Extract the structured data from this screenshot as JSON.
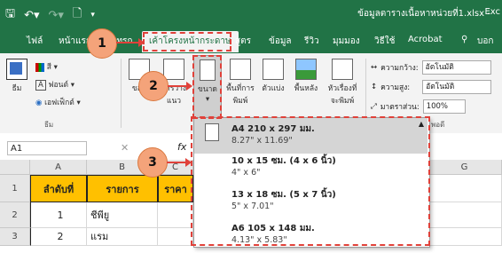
{
  "title_bar": {
    "document_title": "ข้อมูลตารางเนื้อหาหน่วยที่1.xlsx -",
    "app_name": "Exc",
    "save_icon": "save-icon",
    "undo_icon": "undo-icon",
    "redo_icon": "redo-icon",
    "print_preview_icon": "print-preview-icon"
  },
  "tabs": [
    {
      "label": "ไฟล์"
    },
    {
      "label": "หน้าแรก"
    },
    {
      "label": "แทรก"
    },
    {
      "label": "เค้าโครงหน้ากระดาษ",
      "active": true
    },
    {
      "label": "สูตร"
    },
    {
      "label": "ข้อมูล"
    },
    {
      "label": "รีวิว"
    },
    {
      "label": "มุมมอง"
    },
    {
      "label": "วิธีใช้"
    },
    {
      "label": "Acrobat"
    },
    {
      "label": "บอก"
    }
  ],
  "ribbon": {
    "theme": {
      "label": "ธีม",
      "colors": "สี",
      "fonts": "ฟอนต์",
      "effects": "เอฟเฟ็กต์",
      "group": "ธีม"
    },
    "margins": {
      "label": "ขอบ"
    },
    "orientation": {
      "label": "การวาง",
      "sub": "แนว"
    },
    "size": {
      "label": "ขนาด"
    },
    "print_area": {
      "label": "พื้นที่การ",
      "sub": "พิมพ์"
    },
    "breaks": {
      "label": "ตัวแบ่ง"
    },
    "background": {
      "label": "พื้นหลัง"
    },
    "print_titles": {
      "label": "หัวเรื่องที่",
      "sub": "จะพิมพ์"
    },
    "scale_to_fit": {
      "width_label": "ความกว้าง:",
      "width_value": "อัตโนมัติ",
      "height_label": "ความสูง:",
      "height_value": "อัตโนมัติ",
      "scale_label": "มาตราส่วน:",
      "scale_value": "100%",
      "group": "พอดี"
    }
  },
  "formula_bar": {
    "name_box": "A1",
    "fx": "fx"
  },
  "sheet": {
    "columns": [
      "A",
      "B",
      "C",
      "G"
    ],
    "rows": [
      {
        "num": "1",
        "cells": [
          "ลำดับที่",
          "รายการ",
          "ราคา"
        ]
      },
      {
        "num": "2",
        "cells": [
          "1",
          "ชีพียู",
          ""
        ]
      },
      {
        "num": "3",
        "cells": [
          "2",
          "แรม",
          ""
        ]
      }
    ]
  },
  "size_dropdown": {
    "items": [
      {
        "name": "A4 210 x 297 มม.",
        "size": "8.27\" x 11.69\""
      },
      {
        "name": "10 x 15 ซม. (4 x 6 นิ้ว)",
        "size": "4\" x 6\""
      },
      {
        "name": "13 x 18 ซม. (5 x 7 นิ้ว)",
        "size": "5\" x 7.01\""
      },
      {
        "name": "A6 105 x 148 มม.",
        "size": "4.13\" x 5.83\""
      }
    ]
  },
  "callouts": [
    "1",
    "2",
    "3"
  ]
}
